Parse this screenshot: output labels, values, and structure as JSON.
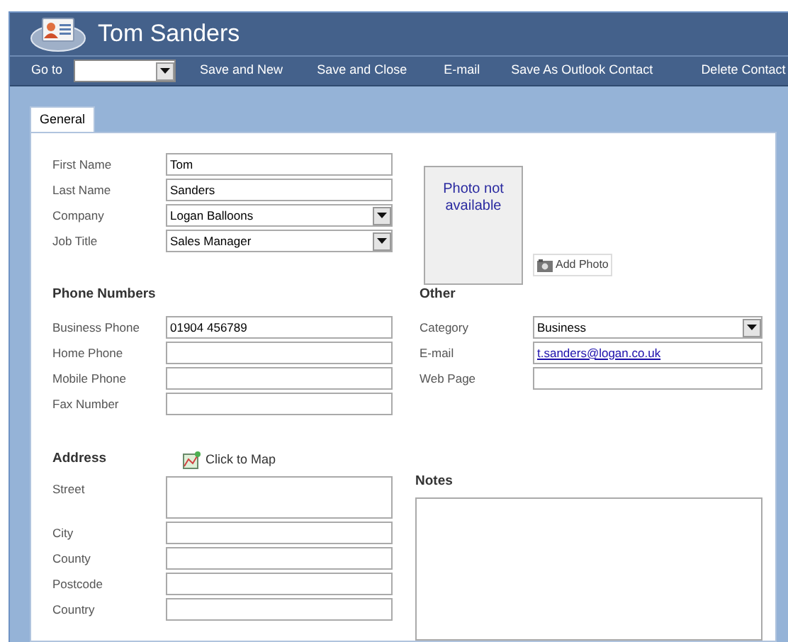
{
  "window": {
    "title": "Tom Sanders"
  },
  "toolbar": {
    "goto": {
      "label": "Go to"
    },
    "actions": [
      {
        "label": "Save and New"
      },
      {
        "label": "Save and Close"
      },
      {
        "label": "E-mail"
      },
      {
        "label": "Save As Outlook Contact"
      },
      {
        "label": "Delete Contact"
      }
    ]
  },
  "tabs": [
    {
      "label": "General",
      "selected": true
    }
  ],
  "name_fields": [
    {
      "label": "First Name",
      "value": "Tom",
      "kind": "text"
    },
    {
      "label": "Last Name",
      "value": "Sanders",
      "kind": "text"
    },
    {
      "label": "Company",
      "value": "Logan Balloons",
      "kind": "dropdown"
    },
    {
      "label": "Job Title",
      "value": "Sales Manager",
      "kind": "dropdown"
    }
  ],
  "photo": {
    "text": "Photo not available",
    "button": {
      "label": "Add Photo"
    }
  },
  "phone_numbers": {
    "heading": "Phone Numbers",
    "fields": [
      {
        "label": "Business Phone",
        "value": "01904 456789",
        "kind": "text"
      },
      {
        "label": "Home Phone",
        "kind": "text"
      },
      {
        "label": "Mobile Phone",
        "kind": "text"
      },
      {
        "label": "Fax Number",
        "kind": "text"
      }
    ]
  },
  "other": {
    "heading": "Other",
    "fields": [
      {
        "label": "Category",
        "value": "Business",
        "kind": "dropdown"
      },
      {
        "label": "E-mail",
        "value": "t.sanders@logan.co.uk",
        "kind": "link"
      },
      {
        "label": "Web Page",
        "kind": "text"
      }
    ]
  },
  "address": {
    "heading": "Address",
    "map_link": "Click to Map",
    "fields": [
      {
        "label": "Street",
        "kind": "multiline"
      },
      {
        "label": "City",
        "kind": "text"
      },
      {
        "label": "County",
        "kind": "text"
      },
      {
        "label": "Postcode",
        "kind": "text"
      },
      {
        "label": "Country",
        "kind": "text"
      }
    ]
  },
  "notes": {
    "heading": "Notes"
  }
}
